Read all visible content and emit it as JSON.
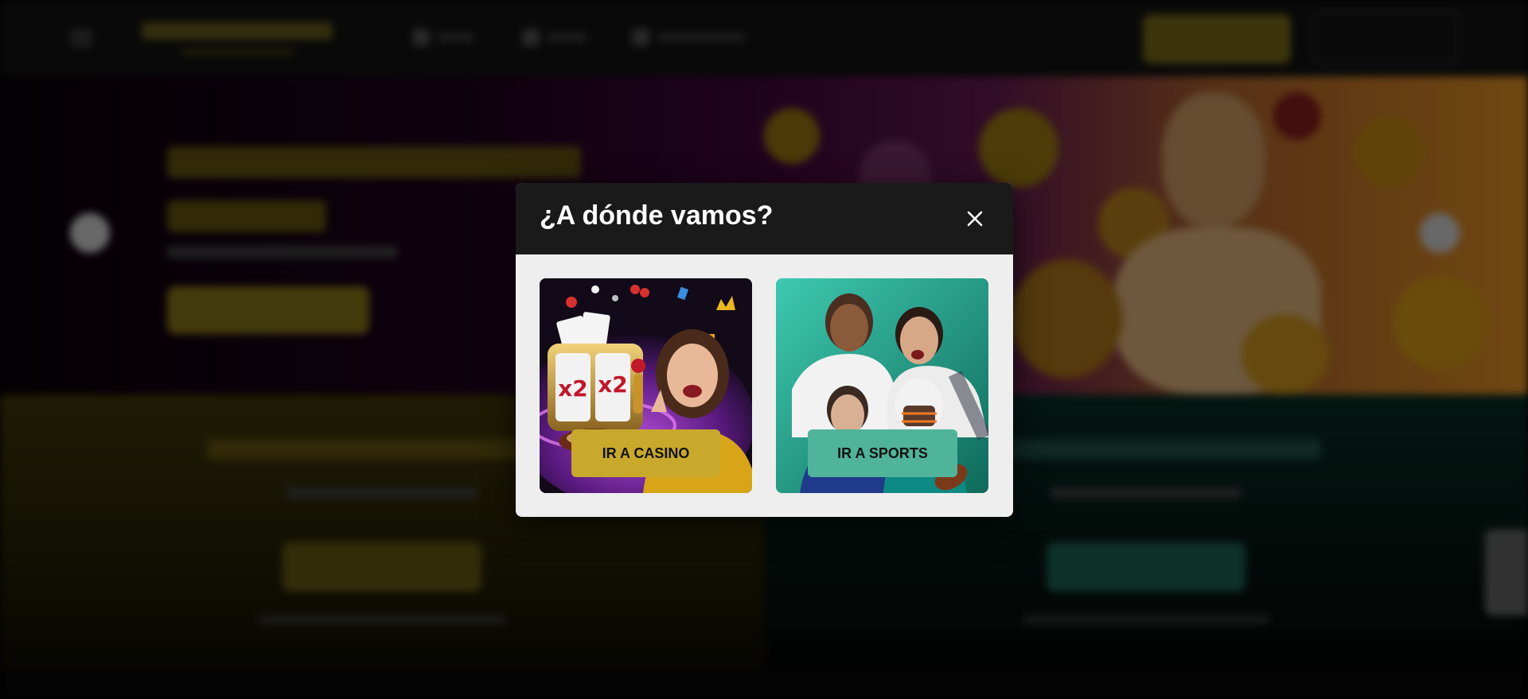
{
  "modal": {
    "title": "¿A dónde vamos?",
    "casino_button": "IR A CASINO",
    "sports_button": "IR A SPORTS"
  },
  "background": {
    "colors": {
      "gold": "#c9a92c",
      "teal": "#4fb49a",
      "overlay": "rgba(0,0,0,0.45)"
    }
  }
}
